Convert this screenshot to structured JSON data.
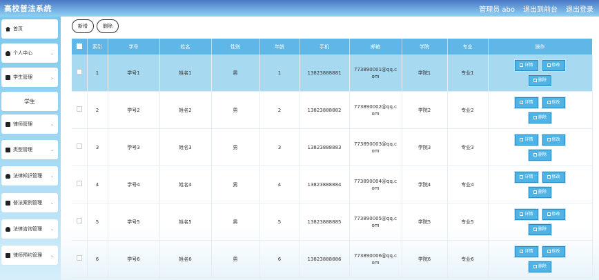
{
  "app": {
    "title": "高校普法系统"
  },
  "topbar": {
    "user": "管理员 abo",
    "front": "退出到前台",
    "logout": "退出登录"
  },
  "sidebar": {
    "items": [
      {
        "label": "首页",
        "icon": "home-icon",
        "expand": false
      },
      {
        "label": "个人中心",
        "icon": "user-icon",
        "expand": true
      },
      {
        "label": "学生管理",
        "icon": "folder-icon",
        "expand": true
      },
      {
        "label": "学生",
        "icon": "",
        "expand": false
      },
      {
        "label": "律师管理",
        "icon": "grid-icon",
        "expand": true
      },
      {
        "label": "类型管理",
        "icon": "grid-icon",
        "expand": true
      },
      {
        "label": "法律知识管理",
        "icon": "user-icon",
        "expand": true
      },
      {
        "label": "普法案例管理",
        "icon": "grid-icon",
        "expand": true
      },
      {
        "label": "法律咨询管理",
        "icon": "user-icon",
        "expand": true
      },
      {
        "label": "律师预约管理",
        "icon": "grid-icon",
        "expand": true
      }
    ]
  },
  "toolbar": {
    "add": "新增",
    "delete": "删除"
  },
  "table": {
    "headers": [
      "",
      "索引",
      "学号",
      "姓名",
      "性别",
      "年龄",
      "手机",
      "邮箱",
      "学院",
      "专业",
      "操作"
    ],
    "rows": [
      {
        "idx": "1",
        "xh": "学号1",
        "xm": "姓名1",
        "xb": "男",
        "nl": "1",
        "sj": "13823888881",
        "yx": "773890001@qq.com",
        "xy": "学院1",
        "zy": "专业1",
        "selected": true
      },
      {
        "idx": "2",
        "xh": "学号2",
        "xm": "姓名2",
        "xb": "男",
        "nl": "2",
        "sj": "13823888882",
        "yx": "773890002@qq.com",
        "xy": "学院2",
        "zy": "专业2",
        "selected": false
      },
      {
        "idx": "3",
        "xh": "学号3",
        "xm": "姓名3",
        "xb": "男",
        "nl": "3",
        "sj": "13823888883",
        "yx": "773890003@qq.com",
        "xy": "学院3",
        "zy": "专业3",
        "selected": false
      },
      {
        "idx": "4",
        "xh": "学号4",
        "xm": "姓名4",
        "xb": "男",
        "nl": "4",
        "sj": "13823888884",
        "yx": "773890004@qq.com",
        "xy": "学院4",
        "zy": "专业4",
        "selected": false
      },
      {
        "idx": "5",
        "xh": "学号5",
        "xm": "姓名5",
        "xb": "男",
        "nl": "5",
        "sj": "13823888885",
        "yx": "773890005@qq.com",
        "xy": "学院5",
        "zy": "专业5",
        "selected": false
      },
      {
        "idx": "6",
        "xh": "学号6",
        "xm": "姓名6",
        "xb": "男",
        "nl": "6",
        "sj": "13823888886",
        "yx": "773890006@qq.com",
        "xy": "学院6",
        "zy": "专业6",
        "selected": false
      }
    ],
    "ops": {
      "detail": "详情",
      "edit": "修改",
      "delete": "删除"
    }
  },
  "colors": {
    "topbar": "#4a78c6",
    "header": "#5fb7e8",
    "selected_row": "#a7d9f0",
    "op_button": "#4fb3e6"
  }
}
